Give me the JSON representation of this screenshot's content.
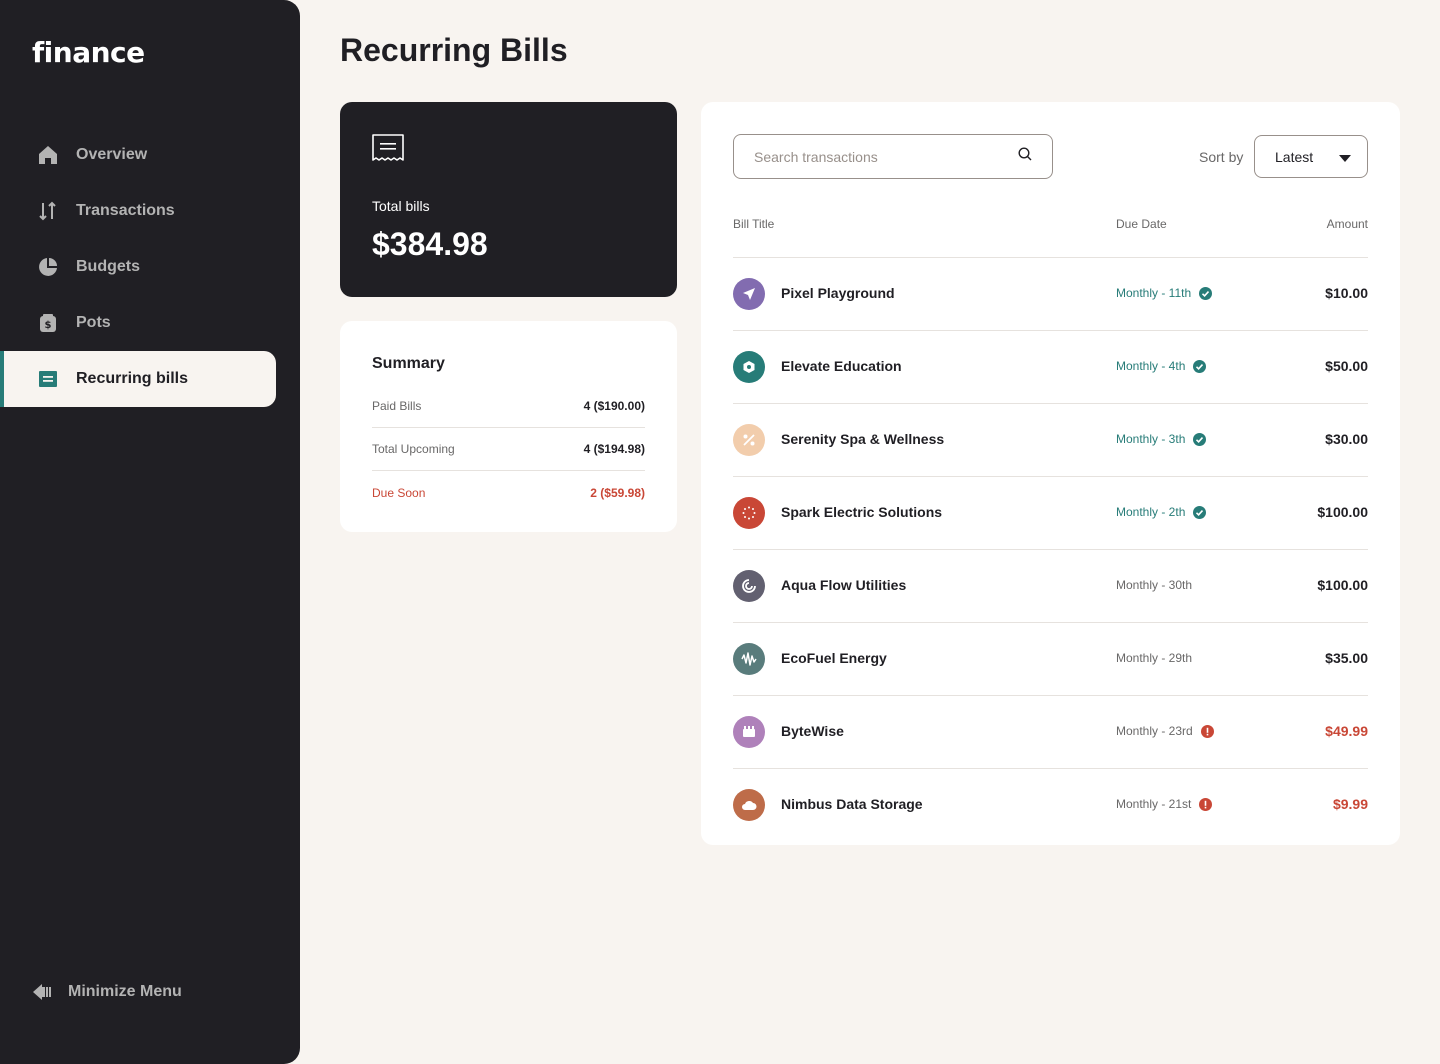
{
  "app": {
    "logo": "finance"
  },
  "sidebar": {
    "items": [
      {
        "label": "Overview",
        "icon": "home-icon",
        "active": false
      },
      {
        "label": "Transactions",
        "icon": "arrows-up-down-icon",
        "active": false
      },
      {
        "label": "Budgets",
        "icon": "pie-chart-icon",
        "active": false
      },
      {
        "label": "Pots",
        "icon": "jar-icon",
        "active": false
      },
      {
        "label": "Recurring bills",
        "icon": "receipt-icon",
        "active": true
      }
    ],
    "minimize_label": "Minimize Menu"
  },
  "page": {
    "title": "Recurring Bills"
  },
  "total": {
    "label": "Total bills",
    "value": "$384.98"
  },
  "summary": {
    "title": "Summary",
    "rows": [
      {
        "label": "Paid Bills",
        "value": "4 ($190.00)"
      },
      {
        "label": "Total Upcoming",
        "value": "4 ($194.98)"
      },
      {
        "label": "Due Soon",
        "value": "2 ($59.98)"
      }
    ]
  },
  "bills": {
    "search_placeholder": "Search transactions",
    "sort_label": "Sort by",
    "sort_value": "Latest",
    "columns": {
      "title": "Bill Title",
      "due": "Due Date",
      "amount": "Amount"
    },
    "rows": [
      {
        "title": "Pixel Playground",
        "due": "Monthly - 11th",
        "amount": "$10.00",
        "status": "paid",
        "color": "#826cb0",
        "icon": "paper-plane-icon"
      },
      {
        "title": "Elevate Education",
        "due": "Monthly - 4th",
        "amount": "$50.00",
        "status": "paid",
        "color": "#277c78",
        "icon": "hexagon-icon"
      },
      {
        "title": "Serenity Spa & Wellness",
        "due": "Monthly - 3th",
        "amount": "$30.00",
        "status": "paid",
        "color": "#f2cdac",
        "icon": "percent-icon"
      },
      {
        "title": "Spark Electric Solutions",
        "due": "Monthly - 2th",
        "amount": "$100.00",
        "status": "paid",
        "color": "#c94736",
        "icon": "dotted-circle-icon"
      },
      {
        "title": "Aqua Flow Utilities",
        "due": "Monthly - 30th",
        "amount": "$100.00",
        "status": "upcoming",
        "color": "#626070",
        "icon": "spiral-icon"
      },
      {
        "title": "EcoFuel Energy",
        "due": "Monthly - 29th",
        "amount": "$35.00",
        "status": "upcoming",
        "color": "#597c7c",
        "icon": "wave-icon"
      },
      {
        "title": "ByteWise",
        "due": "Monthly - 23rd",
        "amount": "$49.99",
        "status": "due-soon",
        "color": "#af81ba",
        "icon": "chip-icon"
      },
      {
        "title": "Nimbus Data Storage",
        "due": "Monthly - 21st",
        "amount": "$9.99",
        "status": "due-soon",
        "color": "#be6c49",
        "icon": "cloud-icon"
      }
    ]
  },
  "colors": {
    "paid": "#277c78",
    "due_soon": "#c94736",
    "sidebar_bg": "#201f24",
    "page_bg": "#f8f4f0"
  }
}
